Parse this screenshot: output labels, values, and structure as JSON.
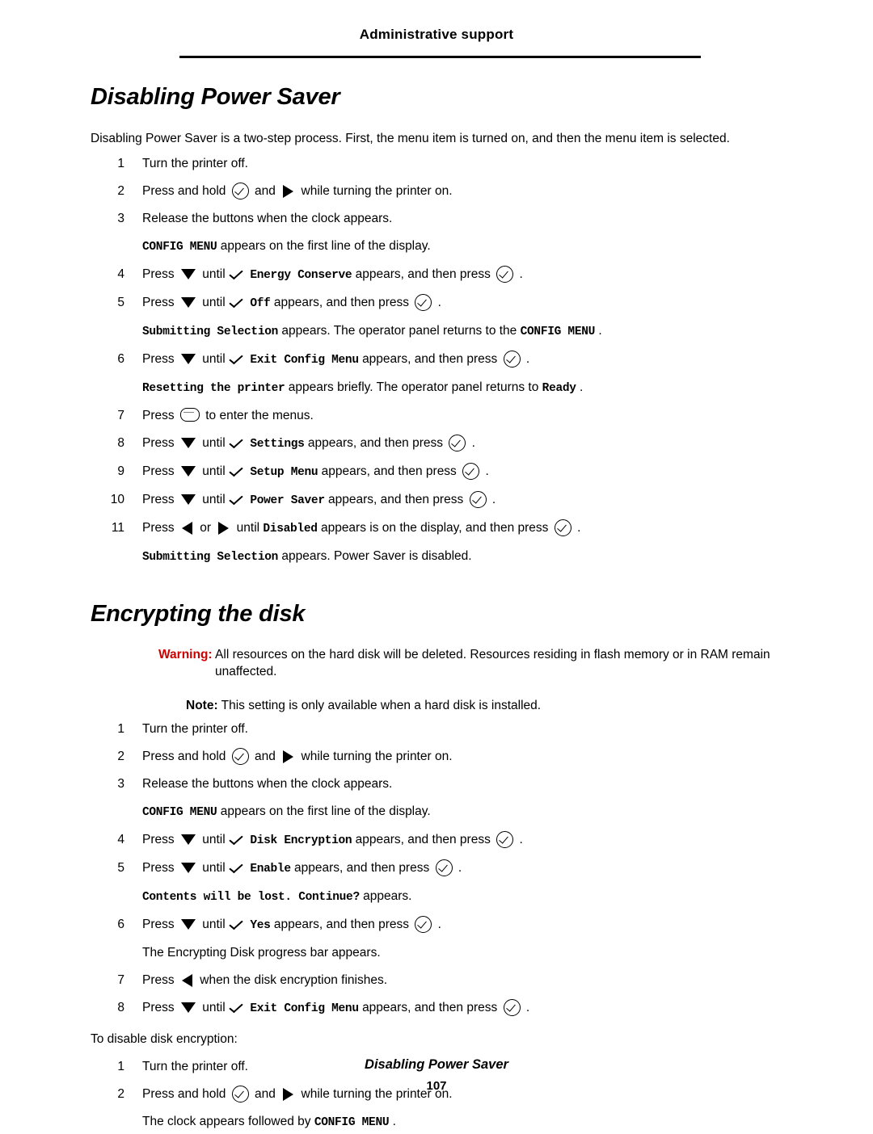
{
  "header": {
    "title": "Administrative support"
  },
  "sections": [
    {
      "heading": "Disabling Power Saver",
      "intro": "Disabling Power Saver is a two-step process. First, the menu item is turned on, and then the menu item is selected.",
      "steps": [
        {
          "num": "1",
          "parts": [
            {
              "t": "text",
              "v": "Turn the printer off."
            }
          ]
        },
        {
          "num": "2",
          "parts": [
            {
              "t": "text",
              "v": "Press and hold"
            },
            {
              "t": "icon",
              "v": "select-button-icon"
            },
            {
              "t": "text",
              "v": "and"
            },
            {
              "t": "icon",
              "v": "right-arrow-icon"
            },
            {
              "t": "text",
              "v": "while turning the printer on."
            }
          ]
        },
        {
          "num": "3",
          "parts": [
            {
              "t": "text",
              "v": "Release the buttons when the clock appears."
            }
          ]
        },
        {
          "num": "",
          "parts": [
            {
              "t": "mono",
              "v": "CONFIG MENU"
            },
            {
              "t": "text",
              "v": "appears on the first line of the display."
            }
          ]
        },
        {
          "num": "4",
          "parts": [
            {
              "t": "text",
              "v": "Press"
            },
            {
              "t": "icon",
              "v": "down-arrow-icon"
            },
            {
              "t": "text",
              "v": "until"
            },
            {
              "t": "icon",
              "v": "checkmark-icon"
            },
            {
              "t": "mono",
              "v": "Energy Conserve"
            },
            {
              "t": "text",
              "v": "appears, and then press"
            },
            {
              "t": "icon",
              "v": "select-button-icon"
            },
            {
              "t": "text",
              "v": "."
            }
          ]
        },
        {
          "num": "5",
          "parts": [
            {
              "t": "text",
              "v": "Press"
            },
            {
              "t": "icon",
              "v": "down-arrow-icon"
            },
            {
              "t": "text",
              "v": "until"
            },
            {
              "t": "icon",
              "v": "checkmark-icon"
            },
            {
              "t": "mono",
              "v": "Off"
            },
            {
              "t": "text",
              "v": "appears, and then press"
            },
            {
              "t": "icon",
              "v": "select-button-icon"
            },
            {
              "t": "text",
              "v": "."
            }
          ]
        },
        {
          "num": "",
          "parts": [
            {
              "t": "mono",
              "v": "Submitting Selection"
            },
            {
              "t": "text",
              "v": "appears. The operator panel returns to the"
            },
            {
              "t": "mono",
              "v": "CONFIG MENU"
            },
            {
              "t": "text",
              "v": "."
            }
          ]
        },
        {
          "num": "6",
          "parts": [
            {
              "t": "text",
              "v": "Press"
            },
            {
              "t": "icon",
              "v": "down-arrow-icon"
            },
            {
              "t": "text",
              "v": "until"
            },
            {
              "t": "icon",
              "v": "checkmark-icon"
            },
            {
              "t": "mono",
              "v": "Exit Config Menu"
            },
            {
              "t": "text",
              "v": "appears, and then press"
            },
            {
              "t": "icon",
              "v": "select-button-icon"
            },
            {
              "t": "text",
              "v": "."
            }
          ]
        },
        {
          "num": "",
          "parts": [
            {
              "t": "mono",
              "v": "Resetting the printer"
            },
            {
              "t": "text",
              "v": "appears briefly. The operator panel returns to"
            },
            {
              "t": "mono",
              "v": "Ready"
            },
            {
              "t": "text",
              "v": "."
            }
          ]
        },
        {
          "num": "7",
          "parts": [
            {
              "t": "text",
              "v": "Press"
            },
            {
              "t": "icon",
              "v": "menu-button-icon"
            },
            {
              "t": "text",
              "v": "to enter the menus."
            }
          ]
        },
        {
          "num": "8",
          "parts": [
            {
              "t": "text",
              "v": "Press"
            },
            {
              "t": "icon",
              "v": "down-arrow-icon"
            },
            {
              "t": "text",
              "v": "until"
            },
            {
              "t": "icon",
              "v": "checkmark-icon"
            },
            {
              "t": "mono",
              "v": "Settings"
            },
            {
              "t": "text",
              "v": "appears, and then press"
            },
            {
              "t": "icon",
              "v": "select-button-icon"
            },
            {
              "t": "text",
              "v": "."
            }
          ]
        },
        {
          "num": "9",
          "parts": [
            {
              "t": "text",
              "v": "Press"
            },
            {
              "t": "icon",
              "v": "down-arrow-icon"
            },
            {
              "t": "text",
              "v": "until"
            },
            {
              "t": "icon",
              "v": "checkmark-icon"
            },
            {
              "t": "mono",
              "v": "Setup Menu"
            },
            {
              "t": "text",
              "v": "appears, and then press"
            },
            {
              "t": "icon",
              "v": "select-button-icon"
            },
            {
              "t": "text",
              "v": "."
            }
          ]
        },
        {
          "num": "10",
          "parts": [
            {
              "t": "text",
              "v": "Press"
            },
            {
              "t": "icon",
              "v": "down-arrow-icon"
            },
            {
              "t": "text",
              "v": "until"
            },
            {
              "t": "icon",
              "v": "checkmark-icon"
            },
            {
              "t": "mono",
              "v": "Power Saver"
            },
            {
              "t": "text",
              "v": "appears, and then press"
            },
            {
              "t": "icon",
              "v": "select-button-icon"
            },
            {
              "t": "text",
              "v": "."
            }
          ]
        },
        {
          "num": "11",
          "parts": [
            {
              "t": "text",
              "v": "Press"
            },
            {
              "t": "icon",
              "v": "left-arrow-icon"
            },
            {
              "t": "text",
              "v": "or"
            },
            {
              "t": "icon",
              "v": "right-arrow-icon"
            },
            {
              "t": "text",
              "v": "until"
            },
            {
              "t": "mono",
              "v": "Disabled"
            },
            {
              "t": "text",
              "v": "appears is on the display, and then press"
            },
            {
              "t": "icon",
              "v": "select-button-icon"
            },
            {
              "t": "text",
              "v": "."
            }
          ]
        },
        {
          "num": "",
          "parts": [
            {
              "t": "mono",
              "v": "Submitting Selection"
            },
            {
              "t": "text",
              "v": "appears. Power Saver is disabled."
            }
          ]
        }
      ]
    },
    {
      "heading": "Encrypting the disk",
      "warning_label": "Warning:",
      "warning_text": "All resources on the hard disk will be deleted. Resources residing in flash memory or in RAM remain",
      "warning_text2": "unaffected.",
      "note_label": "Note:",
      "note_text": "This setting is only available when a hard disk is installed.",
      "steps": [
        {
          "num": "1",
          "parts": [
            {
              "t": "text",
              "v": "Turn the printer off."
            }
          ]
        },
        {
          "num": "2",
          "parts": [
            {
              "t": "text",
              "v": "Press and hold"
            },
            {
              "t": "icon",
              "v": "select-button-icon"
            },
            {
              "t": "text",
              "v": "and"
            },
            {
              "t": "icon",
              "v": "right-arrow-icon"
            },
            {
              "t": "text",
              "v": "while turning the printer on."
            }
          ]
        },
        {
          "num": "3",
          "parts": [
            {
              "t": "text",
              "v": "Release the buttons when the clock appears."
            }
          ]
        },
        {
          "num": "",
          "parts": [
            {
              "t": "mono",
              "v": "CONFIG MENU"
            },
            {
              "t": "text",
              "v": "appears on the first line of the display."
            }
          ]
        },
        {
          "num": "4",
          "parts": [
            {
              "t": "text",
              "v": "Press"
            },
            {
              "t": "icon",
              "v": "down-arrow-icon"
            },
            {
              "t": "text",
              "v": "until"
            },
            {
              "t": "icon",
              "v": "checkmark-icon"
            },
            {
              "t": "mono",
              "v": "Disk Encryption"
            },
            {
              "t": "text",
              "v": "appears, and then press"
            },
            {
              "t": "icon",
              "v": "select-button-icon"
            },
            {
              "t": "text",
              "v": "."
            }
          ]
        },
        {
          "num": "5",
          "parts": [
            {
              "t": "text",
              "v": "Press"
            },
            {
              "t": "icon",
              "v": "down-arrow-icon"
            },
            {
              "t": "text",
              "v": "until"
            },
            {
              "t": "icon",
              "v": "checkmark-icon"
            },
            {
              "t": "mono",
              "v": "Enable"
            },
            {
              "t": "text",
              "v": "appears, and then press"
            },
            {
              "t": "icon",
              "v": "select-button-icon"
            },
            {
              "t": "text",
              "v": "."
            }
          ]
        },
        {
          "num": "",
          "parts": [
            {
              "t": "mono",
              "v": "Contents will be lost. Continue?"
            },
            {
              "t": "text",
              "v": "appears."
            }
          ]
        },
        {
          "num": "6",
          "parts": [
            {
              "t": "text",
              "v": "Press"
            },
            {
              "t": "icon",
              "v": "down-arrow-icon"
            },
            {
              "t": "text",
              "v": "until"
            },
            {
              "t": "icon",
              "v": "checkmark-icon"
            },
            {
              "t": "mono",
              "v": "Yes"
            },
            {
              "t": "text",
              "v": "appears, and then press"
            },
            {
              "t": "icon",
              "v": "select-button-icon"
            },
            {
              "t": "text",
              "v": "."
            }
          ]
        },
        {
          "num": "",
          "parts": [
            {
              "t": "text",
              "v": "The Encrypting Disk progress bar appears."
            }
          ]
        },
        {
          "num": "7",
          "parts": [
            {
              "t": "text",
              "v": "Press"
            },
            {
              "t": "icon",
              "v": "left-arrow-icon"
            },
            {
              "t": "text",
              "v": "when the disk encryption finishes."
            }
          ]
        },
        {
          "num": "8",
          "parts": [
            {
              "t": "text",
              "v": "Press"
            },
            {
              "t": "icon",
              "v": "down-arrow-icon"
            },
            {
              "t": "text",
              "v": "until"
            },
            {
              "t": "icon",
              "v": "checkmark-icon"
            },
            {
              "t": "mono",
              "v": "Exit Config Menu"
            },
            {
              "t": "text",
              "v": "appears, and then press"
            },
            {
              "t": "icon",
              "v": "select-button-icon"
            },
            {
              "t": "text",
              "v": "."
            }
          ]
        }
      ],
      "disable_intro": "To disable disk encryption:",
      "disable_steps": [
        {
          "num": "1",
          "parts": [
            {
              "t": "text",
              "v": "Turn the printer off."
            }
          ]
        },
        {
          "num": "2",
          "parts": [
            {
              "t": "text",
              "v": "Press and hold"
            },
            {
              "t": "icon",
              "v": "select-button-icon"
            },
            {
              "t": "text",
              "v": "and"
            },
            {
              "t": "icon",
              "v": "right-arrow-icon"
            },
            {
              "t": "text",
              "v": "while turning the printer on."
            }
          ]
        },
        {
          "num": "",
          "parts": [
            {
              "t": "text",
              "v": "The clock appears followed by"
            },
            {
              "t": "mono",
              "v": "CONFIG MENU"
            },
            {
              "t": "text",
              "v": "."
            }
          ]
        }
      ]
    }
  ],
  "footer": {
    "title": "Disabling Power Saver",
    "page": "107"
  },
  "colors": {
    "warning": "#cc0000",
    "text": "#000000",
    "background": "#ffffff"
  }
}
